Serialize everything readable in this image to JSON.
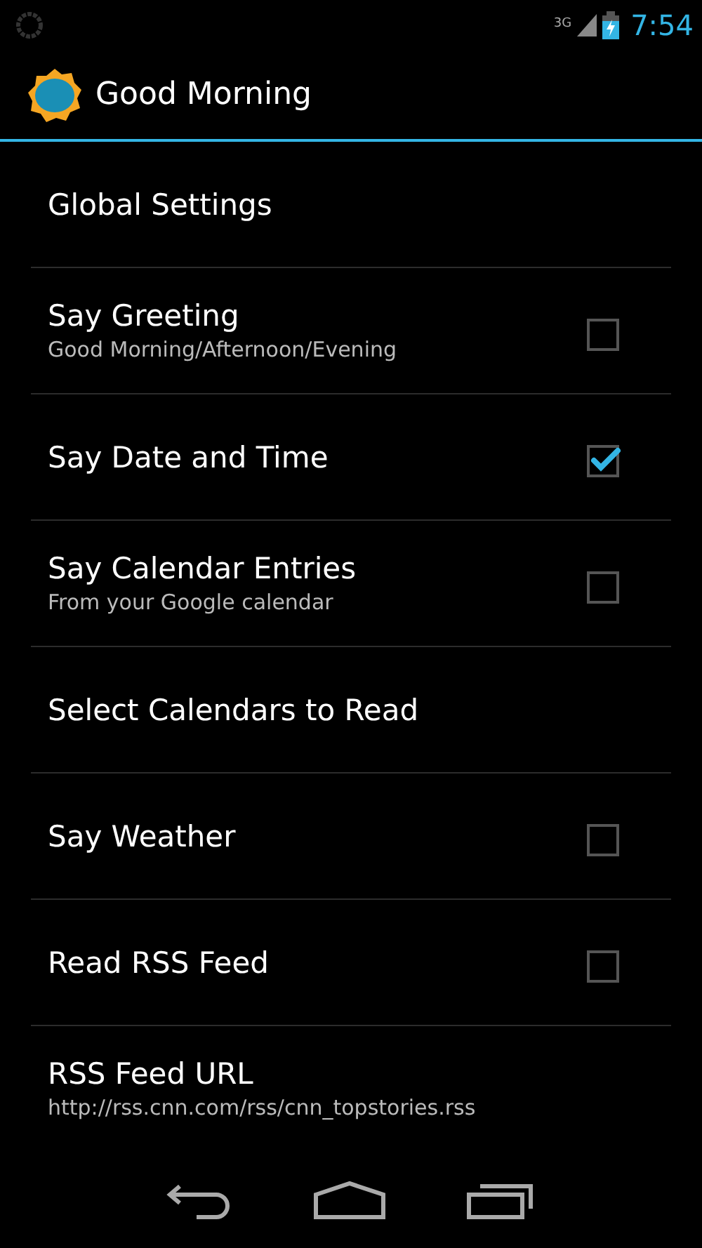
{
  "status_bar": {
    "network": "3G",
    "time": "7:54"
  },
  "action_bar": {
    "title": "Good Morning"
  },
  "preferences": [
    {
      "kind": "plain",
      "title": "Global Settings"
    },
    {
      "kind": "checkbox",
      "title": "Say Greeting",
      "summary": "Good Morning/Afternoon/Evening",
      "checked": false
    },
    {
      "kind": "checkbox",
      "title": "Say Date and Time",
      "checked": true
    },
    {
      "kind": "checkbox",
      "title": "Say Calendar Entries",
      "summary": "From your Google calendar",
      "checked": false
    },
    {
      "kind": "plain",
      "title": "Select Calendars to Read"
    },
    {
      "kind": "checkbox",
      "title": "Say Weather",
      "checked": false
    },
    {
      "kind": "checkbox",
      "title": "Read RSS Feed",
      "checked": false
    },
    {
      "kind": "plain",
      "title": "RSS Feed URL",
      "summary": "http://rss.cnn.com/rss/cnn_topstories.rss"
    }
  ]
}
